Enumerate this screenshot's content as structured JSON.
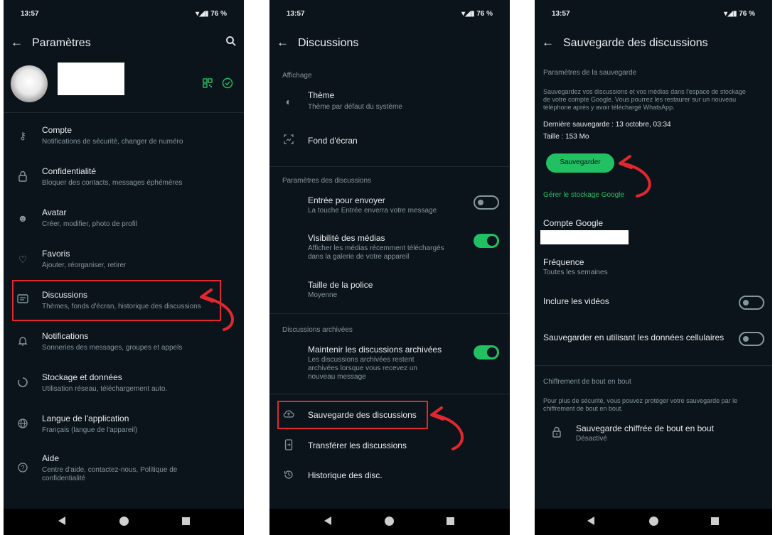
{
  "status": {
    "time": "13:57",
    "battery": "76 %"
  },
  "screen1": {
    "title": "Paramètres",
    "items": [
      {
        "icon": "key-icon",
        "label": "Compte",
        "sub": "Notifications de sécurité, changer de numéro"
      },
      {
        "icon": "lock-icon",
        "label": "Confidentialité",
        "sub": "Bloquer des contacts, messages éphémères"
      },
      {
        "icon": "avatar-face-icon",
        "label": "Avatar",
        "sub": "Créer, modifier, photo de profil"
      },
      {
        "icon": "heart-icon",
        "label": "Favoris",
        "sub": "Ajouter, réorganiser, retirer"
      },
      {
        "icon": "chat-icon",
        "label": "Discussions",
        "sub": "Thèmes, fonds d'écran, historique des discussions"
      },
      {
        "icon": "bell-icon",
        "label": "Notifications",
        "sub": "Sonneries des messages, groupes et appels"
      },
      {
        "icon": "storage-icon",
        "label": "Stockage et données",
        "sub": "Utilisation réseau, téléchargement auto."
      },
      {
        "icon": "globe-icon",
        "label": "Langue de l'application",
        "sub": "Français (langue de l'appareil)"
      },
      {
        "icon": "help-icon",
        "label": "Aide",
        "sub1": "Centre d'aide, contactez-nous, Politique de",
        "sub2": "confidentialité"
      }
    ]
  },
  "screen2": {
    "title": "Discussions",
    "sec_display": "Affichage",
    "theme": {
      "label": "Thème",
      "sub": "Thème par défaut du système"
    },
    "wallpaper": {
      "label": "Fond d'écran"
    },
    "sec_chat_settings": "Paramètres des discussions",
    "enter_send": {
      "label": "Entrée pour envoyer",
      "sub": "La touche Entrée enverra votre message"
    },
    "media_visibility": {
      "label": "Visibilité des médias",
      "sub1": "Afficher les médias récemment téléchargés",
      "sub2": "dans la galerie de votre appareil"
    },
    "font_size": {
      "label": "Taille de la police",
      "sub": "Moyenne"
    },
    "sec_archived": "Discussions archivées",
    "keep_archived": {
      "label": "Maintenir les discussions archivées",
      "sub1": "Les discussions archivées restent",
      "sub2": "archivées lorsque vous recevez un",
      "sub3": "nouveau message"
    },
    "backup": {
      "label": "Sauvegarde des discussions"
    },
    "transfer": {
      "label": "Transférer les discussions"
    },
    "history": {
      "label": "Historique des disc."
    }
  },
  "screen3": {
    "title": "Sauvegarde des discussions",
    "sec_backup_settings": "Paramètres de la sauvegarde",
    "desc1": "Sauvegardez vos discussions et vos médias dans l'espace de stockage",
    "desc2": "de votre compte Google. Vous pourrez les restaurer sur un nouveau",
    "desc3": "téléphone après y avoir téléchargé WhatsApp.",
    "last_backup": "Dernière sauvegarde : 13 octobre, 03:34",
    "size": "Taille : 153 Mo",
    "save_button": "Sauvegarder",
    "manage_link": "Gérer le stockage Google",
    "google_account": "Compte Google",
    "frequency": {
      "label": "Fréquence",
      "sub": "Toutes les semaines"
    },
    "include_videos": "Inclure les vidéos",
    "use_cellular": "Sauvegarder en utilisant les données cellulaires",
    "sec_e2e": "Chiffrement de bout en bout",
    "e2e_desc1": "Pour plus de sécurité, vous pouvez protéger votre sauvegarde par le",
    "e2e_desc2": "chiffrement de bout en bout.",
    "e2e_item": {
      "label": "Sauvegarde chiffrée de bout en bout",
      "sub": "Désactivé"
    }
  },
  "colors": {
    "background": "#0b141a",
    "accent": "#21c063",
    "highlight": "#e2272e"
  }
}
